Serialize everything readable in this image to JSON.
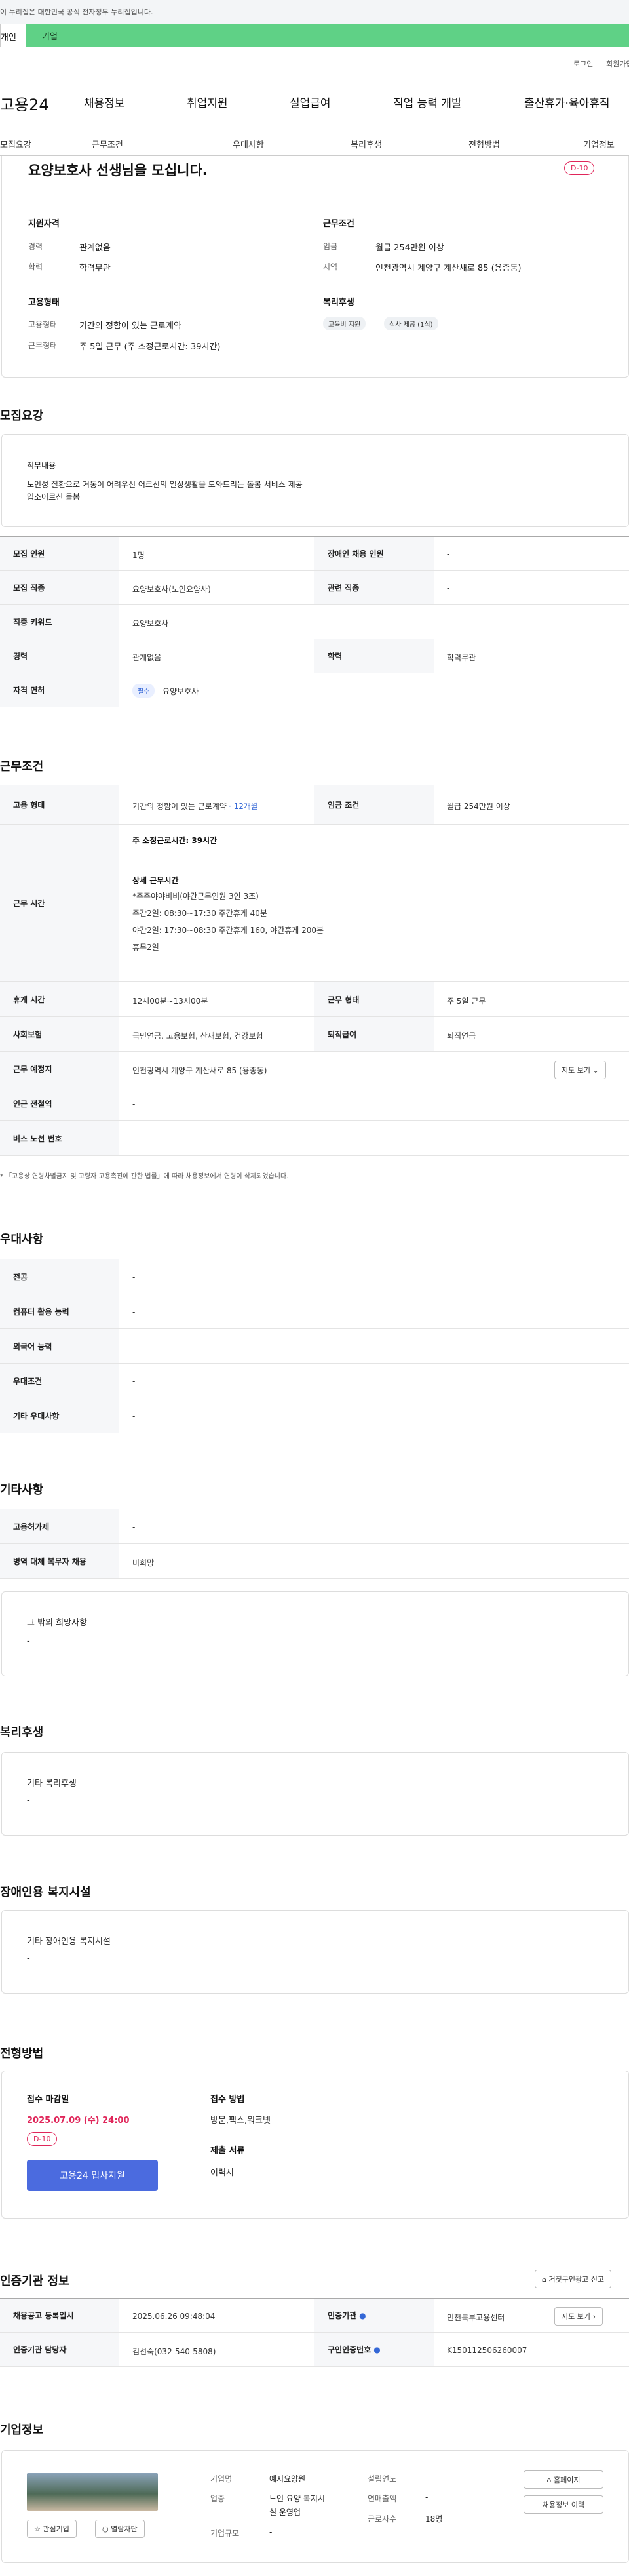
{
  "notice": "이 누리집은 대한민국 공식 전자정부 누리집입니다.",
  "top_tabs": [
    "개인",
    "기업"
  ],
  "top_links": [
    "로그인",
    "회원가입"
  ],
  "logo": "고용24",
  "gnb": [
    "채용정보",
    "취업지원",
    "실업급여",
    "직업 능력 개발",
    "출산휴가·육아휴직"
  ],
  "subnav": [
    "모집요강",
    "근무조건",
    "우대사항",
    "복리후생",
    "전형방법",
    "기업정보"
  ],
  "summary": {
    "title": "요양보호사 선생님을 모십니다.",
    "dday": "D-10",
    "qual_title": "지원자격",
    "career_label": "경력",
    "career": "관계없음",
    "edu_label": "학력",
    "edu": "학력무관",
    "cond_title": "근무조건",
    "wage_label": "임금",
    "wage": "월급 254만원 이상",
    "region_label": "지역",
    "region": "인천광역시 계양구 계산새로 85 (용종동)",
    "emp_title": "고용형태",
    "emptype_label": "고용형태",
    "emptype": "기간의 정함이 있는 근로계약",
    "worktype_label": "근무형태",
    "worktype": "주 5일 근무 (주 소정근로시간: 39시간)",
    "welfare_title": "복리후생",
    "chips": [
      "교육비 지원",
      "식사 제공 (1식)"
    ]
  },
  "recruit": {
    "title": "모집요강",
    "duty_title": "직무내용",
    "duty1": "노인성 질환으로 거동이 어려우신 어르신의 일상생활을 도와드리는 돌봄 서비스 제공",
    "duty2": "입소어르신 돌봄",
    "rows": [
      [
        "모집 인원",
        "1명",
        "장애인 채용 인원",
        "-"
      ],
      [
        "모집 직종",
        "요양보호사(노인요양사)",
        "관련 직종",
        "-"
      ],
      [
        "직종 키워드",
        "요양보호사"
      ],
      [
        "경력",
        "관계없음",
        "학력",
        "학력무관"
      ],
      [
        "자격 면허",
        "요양보호사"
      ]
    ],
    "required": "필수"
  },
  "cond": {
    "title": "근무조건",
    "emp_label": "고용 형태",
    "emp": "기간의 정함이 있는 근로계약",
    "emp_period": "· 12개월",
    "wage_label": "임금 조건",
    "wage": "월급 254만원 이상",
    "time_label": "근무 시간",
    "hours": "주 소정근로시간: 39시간",
    "detail_title": "상세 근무시간",
    "detail": [
      "*주주야야비비(야간근무인원 3인 3조)",
      "주간2일: 08:30~17:30 주간휴게 40분",
      "야간2일: 17:30~08:30  주간휴게 160, 야간휴게 200분",
      "휴무2일"
    ],
    "rest_label": "휴게 시간",
    "rest": "12시00분~13시00분",
    "form_label": "근무 형태",
    "form": "주 5일 근무",
    "ins_label": "사회보험",
    "ins": "국민연금, 고용보험, 산재보험, 건강보험",
    "sev_label": "퇴직급여",
    "sev": "퇴직연금",
    "place_label": "근무 예정지",
    "place": "인천광역시 계양구 계산새로 85 (용종동)",
    "map_btn": "지도 보기",
    "subway_label": "인근 전철역",
    "subway": "-",
    "bus_label": "버스 노선 번호",
    "bus": "-",
    "note": "* 「고용상 연령차별금지 및 고령자 고용촉진에 관한 법률」에 따라 채용정보에서 연령이 삭제되었습니다."
  },
  "pref": {
    "title": "우대사항",
    "rows": [
      [
        "전공",
        "-"
      ],
      [
        "컴퓨터 활용 능력",
        "-"
      ],
      [
        "외국어 능력",
        "-"
      ],
      [
        "우대조건",
        "-"
      ],
      [
        "기타 우대사항",
        "-"
      ]
    ]
  },
  "etc": {
    "title": "기타사항",
    "rows": [
      [
        "고용허가제",
        "-"
      ],
      [
        "병역 대체 복무자 채용",
        "비희망"
      ]
    ],
    "box_title": "그 밖의 희망사항",
    "box_val": "-"
  },
  "welfare": {
    "title": "복리후생",
    "box_title": "기타 복리후생",
    "box_val": "-"
  },
  "disabled": {
    "title": "장애인용 복지시설",
    "box_title": "기타 장애인용 복지시설",
    "box_val": "-"
  },
  "method": {
    "title": "전형방법",
    "deadline_title": "접수 마감일",
    "deadline": "2025.07.09 (수) 24:00",
    "dday": "D-10",
    "apply_btn": "고용24 입사지원",
    "how_title": "접수 방법",
    "how": "방문,팩스,워크넷",
    "docs_title": "제출 서류",
    "docs": "이력서"
  },
  "agency": {
    "title": "인증기관 정보",
    "report_btn": "거짓구인광고 신고",
    "reg_label": "채용공고 등록일시",
    "reg": "2025.06.26 09:48:04",
    "org_label": "인증기관",
    "org": "인천북부고용센터",
    "map_btn": "지도 보기",
    "mgr_label": "인증기관 담당자",
    "mgr": "김선숙(032-540-5808)",
    "no_label": "구인인증번호",
    "no": "K150112506260007"
  },
  "company": {
    "title": "기업정보",
    "name_label": "기업명",
    "name": "예지요양원",
    "ind_label": "업종",
    "ind1": "노인 요양 복지시",
    "ind2": "설 운영업",
    "size_label": "기업규모",
    "size": "-",
    "year_label": "설립연도",
    "year": "-",
    "sales_label": "연매출액",
    "sales": "-",
    "emp_label": "근로자수",
    "emp": "18명",
    "fav_btn": "관심기업",
    "block_btn": "열람차단",
    "home_btn": "홈페이지",
    "hist_btn": "채용정보 이력"
  }
}
